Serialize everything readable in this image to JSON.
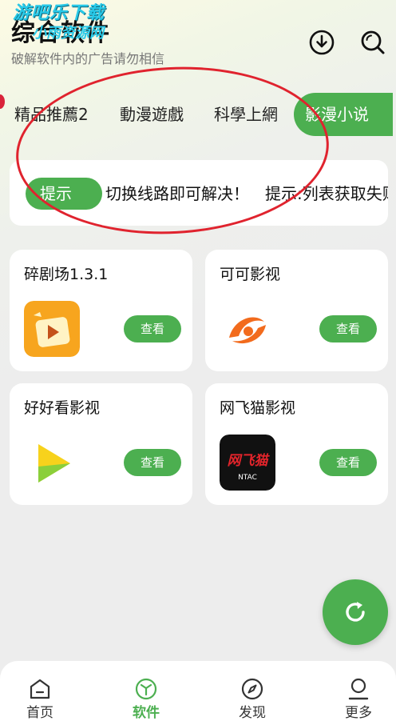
{
  "header": {
    "watermark_line1": "游吧乐下载",
    "watermark_line2": "小雨资源网",
    "title": "综合软件",
    "subtitle": "破解软件内的广告请勿相信",
    "download_icon": "download-icon",
    "search_icon": "search-icon"
  },
  "tabs": [
    {
      "label": "精品推薦2",
      "active": false
    },
    {
      "label": "動漫遊戲",
      "active": false
    },
    {
      "label": "科學上網",
      "active": false
    },
    {
      "label": "影漫小说",
      "active": true
    }
  ],
  "notice": {
    "badge": "提示",
    "text": "切换线路即可解决！　提示:列表获取失败"
  },
  "apps": [
    {
      "name": "碎剧场1.3.1",
      "button": "查看",
      "icon": "play-clapper-icon"
    },
    {
      "name": "可可影视",
      "button": "查看",
      "icon": "orange-swirl-icon"
    },
    {
      "name": "好好看影视",
      "button": "查看",
      "icon": "yellow-green-play-icon"
    },
    {
      "name": "网飞猫影视",
      "button": "查看",
      "icon": "ntac-logo-icon",
      "logo_text": "网飞猫",
      "logo_sub": "NTAC"
    }
  ],
  "fab": {
    "icon": "refresh-icon"
  },
  "bottom_nav": [
    {
      "label": "首页",
      "icon": "home-icon",
      "active": false
    },
    {
      "label": "软件",
      "icon": "software-cube-icon",
      "active": true
    },
    {
      "label": "发现",
      "icon": "compass-icon",
      "active": false
    },
    {
      "label": "更多",
      "icon": "profile-icon",
      "active": false
    }
  ],
  "colors": {
    "accent": "#4caf50",
    "annotation": "#e0232e",
    "background": "#ededed"
  }
}
